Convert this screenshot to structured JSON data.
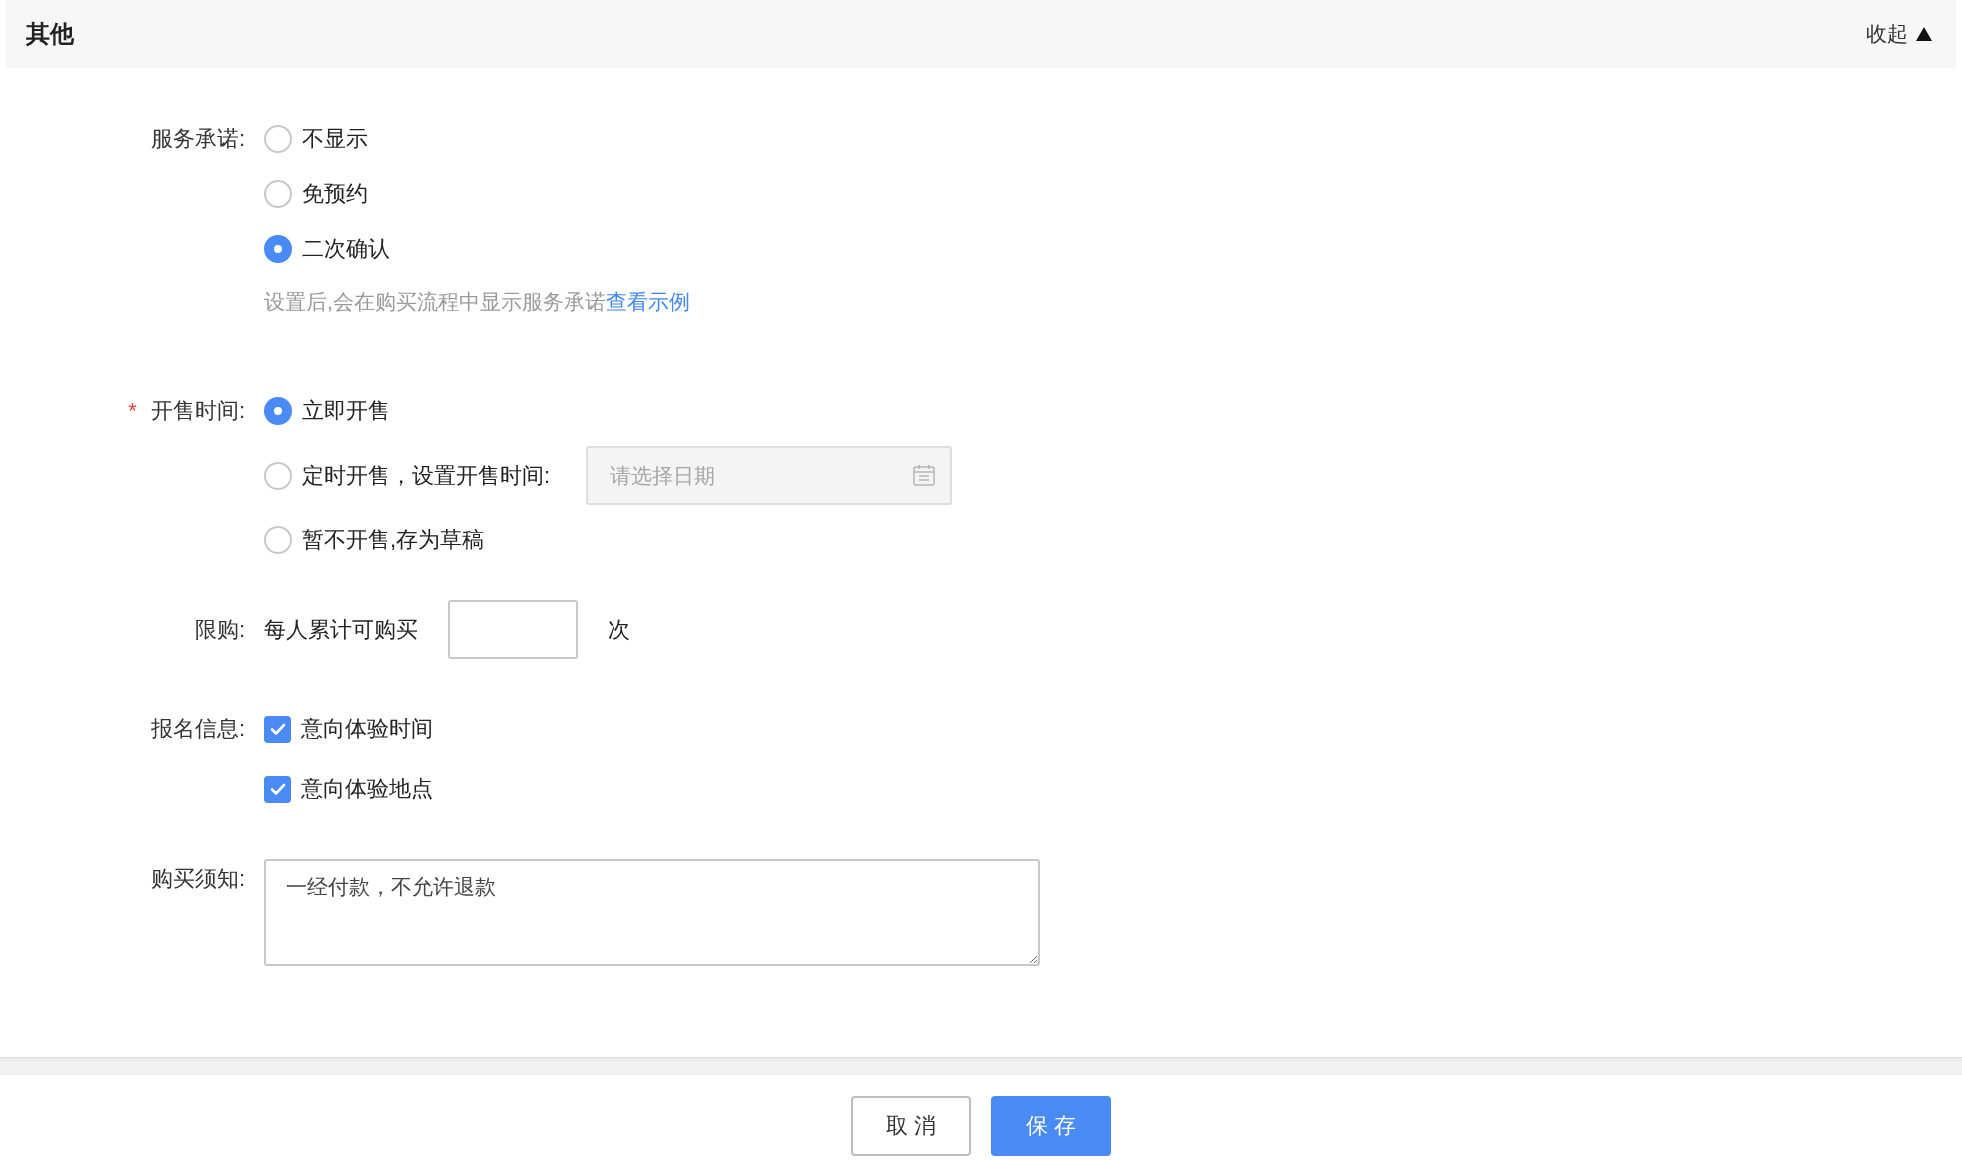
{
  "header": {
    "title": "其他",
    "toggle": "收起"
  },
  "fields": [
    {
      "kind": "radio",
      "label": "服务承诺:",
      "options": [
        {
          "label": "不显示",
          "selected": false
        },
        {
          "label": "免预约",
          "selected": false
        },
        {
          "label": "二次确认",
          "selected": true
        }
      ],
      "hint": "设置后,会在购买流程中显示服务承诺",
      "hint_link": "查看示例"
    },
    {
      "kind": "radio",
      "label": "开售时间:",
      "required_mark": "*",
      "options": [
        {
          "label": "立即开售",
          "selected": true
        },
        {
          "label": "定时开售，设置开售时间:",
          "selected": false,
          "date_field": {
            "placeholder": "请选择日期"
          }
        },
        {
          "label": "暂不开售,存为草稿",
          "selected": false
        }
      ]
    },
    {
      "kind": "limit",
      "label": "限购:",
      "prefix": "每人累计可购买",
      "suffix": "次"
    },
    {
      "kind": "checkbox",
      "label": "报名信息:",
      "options": [
        {
          "label": "意向体验时间",
          "checked": true
        },
        {
          "label": "意向体验地点",
          "checked": true
        }
      ]
    },
    {
      "kind": "textarea",
      "label": "购买须知:",
      "value": "一经付款，不允许退款"
    }
  ],
  "buttons": [
    {
      "label": "取 消",
      "kind": "secondary"
    },
    {
      "label": "保 存",
      "kind": "primary"
    }
  ]
}
